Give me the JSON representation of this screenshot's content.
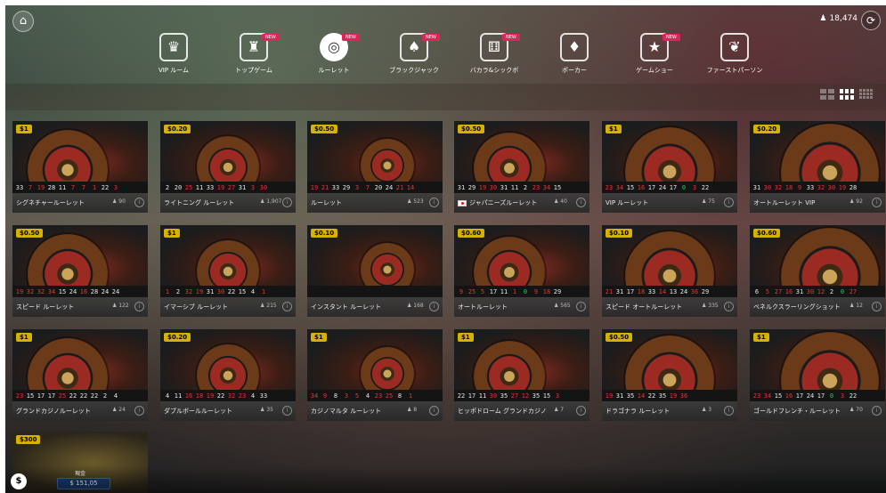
{
  "header": {
    "balance": "18,474",
    "balance_icon": "player-icon"
  },
  "nav": [
    {
      "label": "VIP ルーム",
      "icon": "vip-crown-icon",
      "glyph": "♛",
      "badge": ""
    },
    {
      "label": "トップゲーム",
      "icon": "trophy-icon",
      "glyph": "♜",
      "badge": "NEW"
    },
    {
      "label": "ルーレット",
      "icon": "roulette-icon",
      "glyph": "◎",
      "badge": "NEW",
      "active": true
    },
    {
      "label": "ブラックジャック",
      "icon": "blackjack-cards-icon",
      "glyph": "♠",
      "badge": "NEW"
    },
    {
      "label": "バカラ&シックボ",
      "icon": "dice-icon",
      "glyph": "⚅",
      "badge": "NEW"
    },
    {
      "label": "ポーカー",
      "icon": "poker-cards-icon",
      "glyph": "♦",
      "badge": ""
    },
    {
      "label": "ゲームショー",
      "icon": "game-show-icon",
      "glyph": "★",
      "badge": "NEW"
    },
    {
      "label": "ファーストパーソン",
      "icon": "first-person-icon",
      "glyph": "❦",
      "badge": ""
    }
  ],
  "view_toggle": [
    "grid-2-icon",
    "grid-3-icon",
    "grid-4-icon"
  ],
  "games": [
    {
      "name": "シグネチャールーレット",
      "limit": "$1",
      "players": "90",
      "results": [
        [
          "33",
          "b"
        ],
        [
          "7",
          "r"
        ],
        [
          "19",
          "r"
        ],
        [
          "28",
          "b"
        ],
        [
          "11",
          "b"
        ],
        [
          "7",
          "r"
        ],
        [
          "7",
          "r"
        ],
        [
          "1",
          "r"
        ],
        [
          "22",
          "b"
        ],
        [
          "3",
          "r"
        ]
      ]
    },
    {
      "name": "ライトニング ルーレット",
      "limit": "$0.20",
      "players": "1,907",
      "results": [
        [
          "2",
          "b"
        ],
        [
          "20",
          "b"
        ],
        [
          "25",
          "r"
        ],
        [
          "11",
          "b"
        ],
        [
          "33",
          "b"
        ],
        [
          "19",
          "r"
        ],
        [
          "27",
          "r"
        ],
        [
          "31",
          "b"
        ],
        [
          "3",
          "r"
        ],
        [
          "30",
          "r"
        ]
      ]
    },
    {
      "name": "ルーレット",
      "limit": "$0.50",
      "players": "523",
      "results": [
        [
          "19",
          "r"
        ],
        [
          "21",
          "r"
        ],
        [
          "33",
          "b"
        ],
        [
          "29",
          "b"
        ],
        [
          "3",
          "r"
        ],
        [
          "7",
          "r"
        ],
        [
          "20",
          "b"
        ],
        [
          "24",
          "b"
        ],
        [
          "21",
          "r"
        ],
        [
          "14",
          "r"
        ]
      ]
    },
    {
      "name": "ジャパニーズルーレット",
      "limit": "$0.50",
      "players": "40",
      "flag": true,
      "results": [
        [
          "31",
          "b"
        ],
        [
          "29",
          "b"
        ],
        [
          "19",
          "r"
        ],
        [
          "30",
          "r"
        ],
        [
          "31",
          "b"
        ],
        [
          "11",
          "b"
        ],
        [
          "2",
          "b"
        ],
        [
          "23",
          "r"
        ],
        [
          "34",
          "r"
        ],
        [
          "15",
          "b"
        ]
      ]
    },
    {
      "name": "VIP ルーレット",
      "limit": "$1",
      "players": "75",
      "results": [
        [
          "23",
          "r"
        ],
        [
          "34",
          "r"
        ],
        [
          "15",
          "b"
        ],
        [
          "16",
          "r"
        ],
        [
          "17",
          "b"
        ],
        [
          "24",
          "b"
        ],
        [
          "17",
          "b"
        ],
        [
          "0",
          "g"
        ],
        [
          "3",
          "r"
        ],
        [
          "22",
          "b"
        ]
      ]
    },
    {
      "name": "オートルーレット VIP",
      "limit": "$0.20",
      "players": "92",
      "results": [
        [
          "31",
          "b"
        ],
        [
          "30",
          "r"
        ],
        [
          "32",
          "r"
        ],
        [
          "18",
          "r"
        ],
        [
          "9",
          "r"
        ],
        [
          "33",
          "b"
        ],
        [
          "32",
          "r"
        ],
        [
          "30",
          "r"
        ],
        [
          "19",
          "r"
        ],
        [
          "28",
          "b"
        ]
      ]
    },
    {
      "name": "スピード ルーレット",
      "limit": "$0.50",
      "players": "122",
      "results": [
        [
          "19",
          "r"
        ],
        [
          "32",
          "r"
        ],
        [
          "32",
          "r"
        ],
        [
          "34",
          "r"
        ],
        [
          "15",
          "b"
        ],
        [
          "24",
          "b"
        ],
        [
          "16",
          "r"
        ],
        [
          "28",
          "b"
        ],
        [
          "24",
          "b"
        ],
        [
          "24",
          "b"
        ]
      ]
    },
    {
      "name": "イマーシブ ルーレット",
      "limit": "$1",
      "players": "215",
      "results": [
        [
          "1",
          "r"
        ],
        [
          "2",
          "b"
        ],
        [
          "32",
          "r"
        ],
        [
          "19",
          "r"
        ],
        [
          "31",
          "b"
        ],
        [
          "30",
          "r"
        ],
        [
          "22",
          "b"
        ],
        [
          "15",
          "b"
        ],
        [
          "4",
          "b"
        ],
        [
          "1",
          "r"
        ]
      ]
    },
    {
      "name": "インスタント ルーレット",
      "limit": "$0.10",
      "players": "168",
      "results": []
    },
    {
      "name": "オートルーレット",
      "limit": "$0.60",
      "players": "565",
      "results": [
        [
          "9",
          "r"
        ],
        [
          "25",
          "r"
        ],
        [
          "5",
          "r"
        ],
        [
          "17",
          "b"
        ],
        [
          "11",
          "b"
        ],
        [
          "1",
          "r"
        ],
        [
          "0",
          "g"
        ],
        [
          "9",
          "r"
        ],
        [
          "18",
          "r"
        ],
        [
          "29",
          "b"
        ]
      ]
    },
    {
      "name": "スピード オートルーレット",
      "limit": "$0.10",
      "players": "335",
      "results": [
        [
          "21",
          "r"
        ],
        [
          "31",
          "b"
        ],
        [
          "17",
          "b"
        ],
        [
          "18",
          "r"
        ],
        [
          "33",
          "b"
        ],
        [
          "14",
          "r"
        ],
        [
          "13",
          "b"
        ],
        [
          "24",
          "b"
        ],
        [
          "36",
          "r"
        ],
        [
          "29",
          "b"
        ]
      ]
    },
    {
      "name": "ベネルクスラーリングショット",
      "limit": "$0.60",
      "players": "12",
      "results": [
        [
          "6",
          "b"
        ],
        [
          "5",
          "r"
        ],
        [
          "27",
          "r"
        ],
        [
          "16",
          "r"
        ],
        [
          "31",
          "b"
        ],
        [
          "30",
          "r"
        ],
        [
          "12",
          "r"
        ],
        [
          "2",
          "b"
        ],
        [
          "0",
          "g"
        ],
        [
          "27",
          "r"
        ]
      ]
    },
    {
      "name": "グランドカジノルーレット",
      "limit": "$1",
      "players": "24",
      "results": [
        [
          "23",
          "r"
        ],
        [
          "15",
          "b"
        ],
        [
          "17",
          "b"
        ],
        [
          "17",
          "b"
        ],
        [
          "25",
          "r"
        ],
        [
          "22",
          "b"
        ],
        [
          "22",
          "b"
        ],
        [
          "22",
          "b"
        ],
        [
          "2",
          "b"
        ],
        [
          "4",
          "b"
        ]
      ]
    },
    {
      "name": "ダブルボールルーレット",
      "limit": "$0.20",
      "players": "35",
      "results": [
        [
          "4",
          "b"
        ],
        [
          "11",
          "b"
        ],
        [
          "16",
          "r"
        ],
        [
          "18",
          "r"
        ],
        [
          "19",
          "r"
        ],
        [
          "22",
          "b"
        ],
        [
          "32",
          "r"
        ],
        [
          "23",
          "r"
        ],
        [
          "4",
          "b"
        ],
        [
          "33",
          "b"
        ]
      ]
    },
    {
      "name": "カジノマルタ ルーレット",
      "limit": "$1",
      "players": "8",
      "results": [
        [
          "34",
          "r"
        ],
        [
          "9",
          "r"
        ],
        [
          "8",
          "b"
        ],
        [
          "3",
          "r"
        ],
        [
          "5",
          "r"
        ],
        [
          "4",
          "b"
        ],
        [
          "23",
          "r"
        ],
        [
          "25",
          "r"
        ],
        [
          "8",
          "b"
        ],
        [
          "1",
          "r"
        ]
      ]
    },
    {
      "name": "ヒッポドローム グランドカジノ",
      "limit": "$1",
      "players": "7",
      "results": [
        [
          "22",
          "b"
        ],
        [
          "17",
          "b"
        ],
        [
          "11",
          "b"
        ],
        [
          "30",
          "r"
        ],
        [
          "35",
          "b"
        ],
        [
          "27",
          "r"
        ],
        [
          "12",
          "r"
        ],
        [
          "35",
          "b"
        ],
        [
          "15",
          "b"
        ],
        [
          "3",
          "r"
        ]
      ]
    },
    {
      "name": "ドラゴナラ ルーレット",
      "limit": "$0.50",
      "players": "3",
      "results": [
        [
          "19",
          "r"
        ],
        [
          "31",
          "b"
        ],
        [
          "35",
          "b"
        ],
        [
          "14",
          "r"
        ],
        [
          "22",
          "b"
        ],
        [
          "35",
          "b"
        ],
        [
          "19",
          "r"
        ],
        [
          "36",
          "r"
        ]
      ]
    },
    {
      "name": "ゴールドフレンチ・ルーレット",
      "limit": "$1",
      "players": "70",
      "results": [
        [
          "23",
          "r"
        ],
        [
          "34",
          "r"
        ],
        [
          "15",
          "b"
        ],
        [
          "16",
          "r"
        ],
        [
          "17",
          "b"
        ],
        [
          "24",
          "b"
        ],
        [
          "17",
          "b"
        ],
        [
          "0",
          "g"
        ],
        [
          "3",
          "r"
        ],
        [
          "22",
          "b"
        ]
      ]
    }
  ],
  "jackpot": {
    "limit": "$300",
    "label": "現金",
    "amount": "$ 151,05"
  },
  "bottom_icon": "$"
}
